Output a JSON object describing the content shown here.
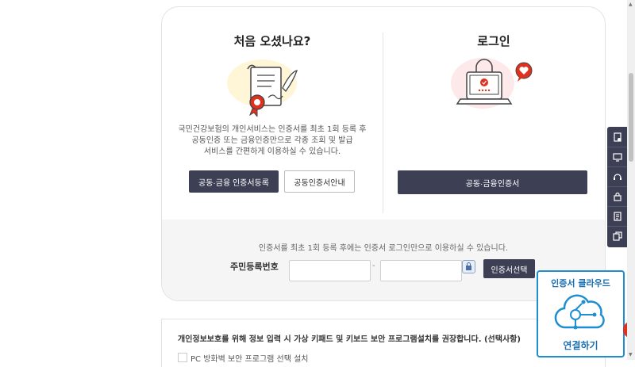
{
  "left_panel": {
    "heading": "처음 오셨나요?",
    "description_lines": [
      "국민건강보험의 개인서비스는 인증서를 최초 1회 등록 후",
      "공동인증 또는 금융인증만으로 각종 조회 및 발급",
      "서비스를 간편하게 이용하실 수 있습니다."
    ],
    "register_button": "공동·금융 인증서등록",
    "guide_button": "공동인증서안내"
  },
  "right_panel": {
    "heading": "로그인",
    "login_button": "공동·금융인증서"
  },
  "login_form": {
    "notice": "인증서를 최초 1회 등록 후에는 인증서 로그인만으로 이용하실 수 있습니다.",
    "rrn_label": "주민등록번호",
    "separator": "-",
    "cert_select_button": "인증서선택"
  },
  "security_notice": {
    "text": "개인정보보호를 위해 정보 입력 시 가상 키패드 및 키보드 보안 프로그램설치를 권장합니다. (선택사항)",
    "checkbox_label": "PC 방화벽 보안 프로그램 선택 설치"
  },
  "cloud_widget": {
    "title": "인증서 클라우드",
    "connect": "연결하기"
  },
  "side_menu": {
    "items": [
      "certificate-icon",
      "monitor-icon",
      "headset-icon",
      "lock-icon",
      "document-icon",
      "copy-icon"
    ]
  },
  "colors": {
    "primary_dark": "#3d3f55",
    "cloud_blue": "#1f8ed1",
    "accent_red": "#e0301e",
    "gray_bg": "#f5f5f5"
  }
}
